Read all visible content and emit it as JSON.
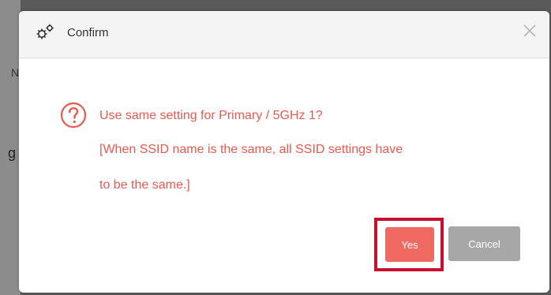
{
  "dialog": {
    "title": "Confirm",
    "header_icon": "gears-icon",
    "close_icon": "close-icon",
    "close_symbol": "×",
    "question_icon": "question-circle-icon",
    "message_lines": [
      "Use same setting for Primary / 5GHz 1?",
      "[When SSID name is the same, all SSID settings have",
      "to be the same.]"
    ],
    "buttons": {
      "yes_label": "Yes",
      "cancel_label": "Cancel"
    }
  },
  "colors": {
    "message_text": "#e8594f",
    "yes_button": "#ef6a62",
    "cancel_button": "#a7a7a7",
    "highlight_border": "#c8102e",
    "header_bg": "#f4f4f4"
  },
  "backdrop": {
    "edge_glyph_top": "N",
    "edge_glyph_mid": "g"
  }
}
